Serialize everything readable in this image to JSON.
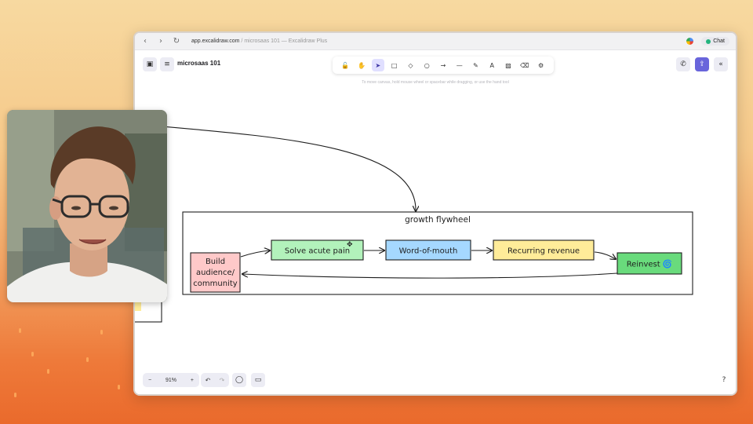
{
  "browser": {
    "url_host": "app.excalidraw.com",
    "url_rest": " / microsaas 101 — Excalidraw Plus",
    "chat_label": "Chat"
  },
  "app": {
    "title": "microsaas 101",
    "hint": "To move canvas, hold mouse wheel or spacebar while dragging, or use the hand tool",
    "zoom": "91%"
  },
  "toolbar": {
    "tools": [
      "lock-icon",
      "hand-icon",
      "selection-icon",
      "rectangle-icon",
      "diamond-icon",
      "ellipse-icon",
      "arrow-icon",
      "line-icon",
      "pencil-icon",
      "text-icon",
      "image-icon",
      "eraser-icon",
      "extra-tools-icon"
    ],
    "active_index": 2
  },
  "diagram": {
    "frame_label": "growth flywheel",
    "nodes": [
      {
        "label_lines": [
          "Build",
          "audience/",
          "community"
        ],
        "color": "#ffc9c9"
      },
      {
        "label_lines": [
          "Solve acute pain"
        ],
        "color": "#b2f2bb"
      },
      {
        "label_lines": [
          "Word-of-mouth"
        ],
        "color": "#a5d8ff"
      },
      {
        "label_lines": [
          "Recurring revenue"
        ],
        "color": "#ffec99"
      },
      {
        "label_lines": [
          "Reinvest 🌀"
        ],
        "color": "#69db7c"
      }
    ]
  },
  "colors": {
    "accent": "#6965db",
    "page_gradient_top": "#f7d9a0",
    "page_gradient_bottom": "#ea6a2c"
  }
}
